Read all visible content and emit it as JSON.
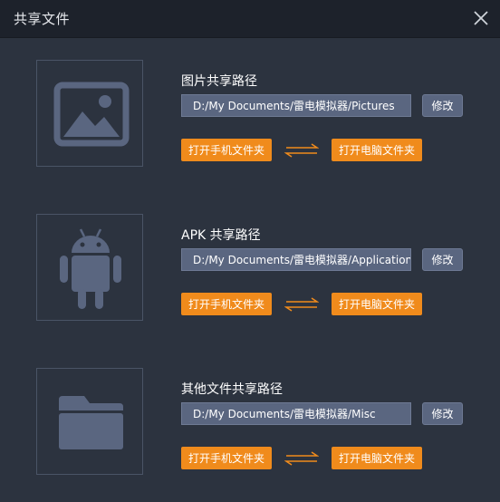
{
  "window": {
    "title": "共享文件"
  },
  "sections": [
    {
      "icon": "image-icon",
      "label": "图片共享路径",
      "path": "D:/My Documents/雷电模拟器/Pictures",
      "modify_label": "修改",
      "open_phone_label": "打开手机文件夹",
      "open_pc_label": "打开电脑文件夹"
    },
    {
      "icon": "android-icon",
      "label": "APK 共享路径",
      "path": "D:/My Documents/雷电模拟器/Applications",
      "modify_label": "修改",
      "open_phone_label": "打开手机文件夹",
      "open_pc_label": "打开电脑文件夹"
    },
    {
      "icon": "folder-icon",
      "label": "其他文件共享路径",
      "path": "D:/My Documents/雷电模拟器/Misc",
      "modify_label": "修改",
      "open_phone_label": "打开手机文件夹",
      "open_pc_label": "打开电脑文件夹"
    }
  ],
  "colors": {
    "titlebar": "#1d222b",
    "background": "#2c333f",
    "accent": "#f08b1c",
    "icon": "#5a6680"
  }
}
